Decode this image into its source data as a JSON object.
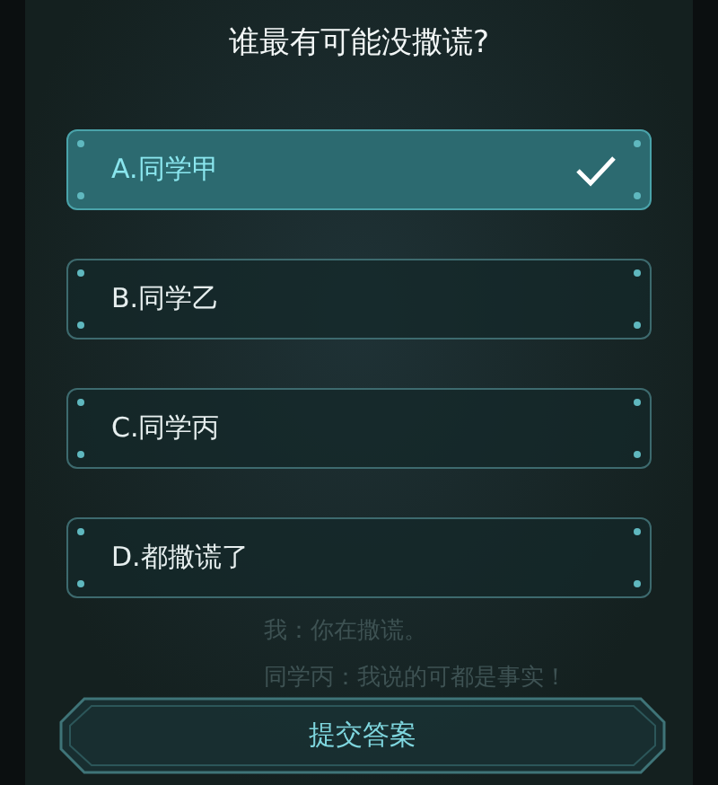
{
  "question": "谁最有可能没撒谎?",
  "options": [
    {
      "label": "A.同学甲",
      "selected": true
    },
    {
      "label": "B.同学乙",
      "selected": false
    },
    {
      "label": "C.同学丙",
      "selected": false
    },
    {
      "label": "D.都撒谎了",
      "selected": false
    }
  ],
  "background_lines": [
    "我：你在撒谎。",
    "同学丙：我说的可都是事实！"
  ],
  "submit_button": "提交答案"
}
